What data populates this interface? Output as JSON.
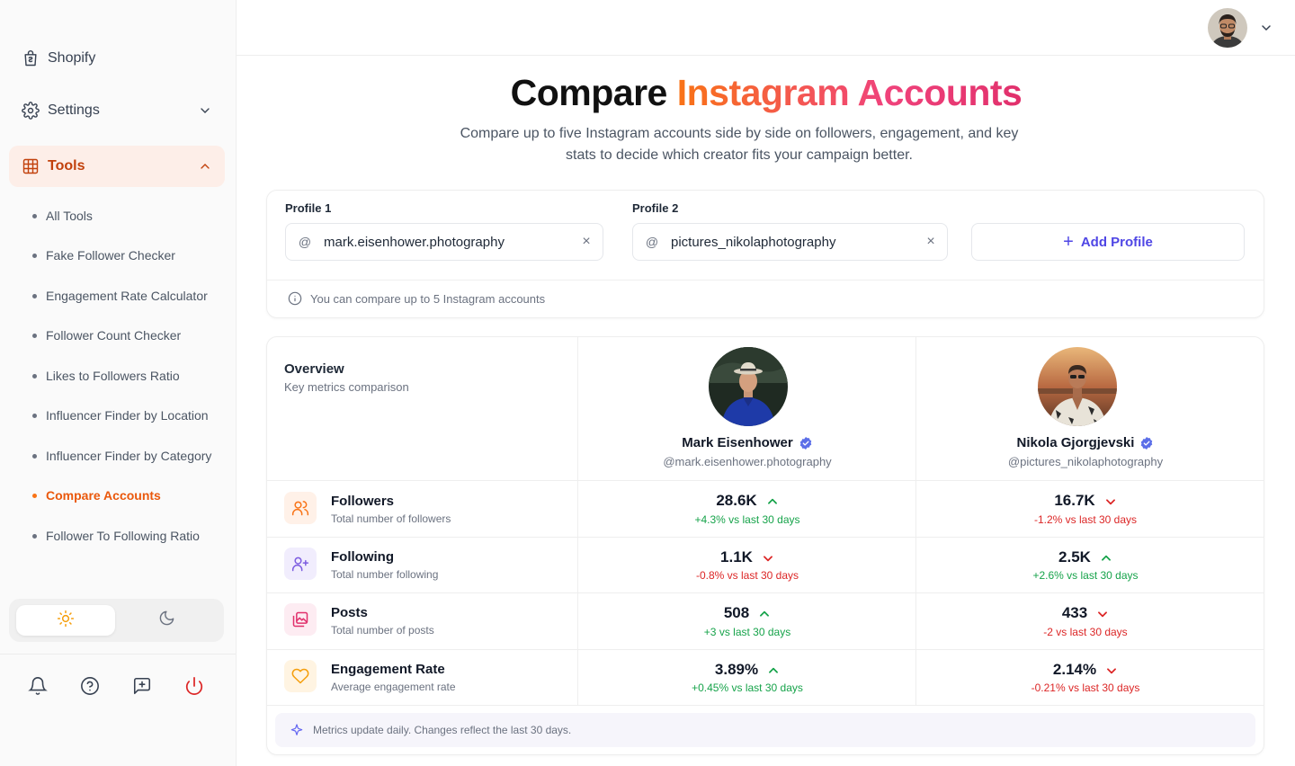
{
  "sidebar": {
    "shopify": "Shopify",
    "settings": "Settings",
    "tools": "Tools",
    "tool_items": [
      "All Tools",
      "Fake Follower Checker",
      "Engagement Rate Calculator",
      "Follower Count Checker",
      "Likes to Followers Ratio",
      "Influencer Finder by Location",
      "Influencer Finder by Category",
      "Compare Accounts",
      "Follower To Following Ratio"
    ],
    "active_item": "Compare Accounts",
    "theme_selected": "light",
    "footer_icons": [
      "bell-icon",
      "help-icon",
      "feedback-icon",
      "power-icon"
    ]
  },
  "header": {
    "user_menu_icon": "chevron-down-icon"
  },
  "hero": {
    "title_plain": "Compare ",
    "title_gradient": "Instagram Accounts",
    "subtitle": "Compare up to five Instagram accounts side by side on followers, engagement, and key stats to decide which creator fits your campaign better."
  },
  "profiles": {
    "profile1_label": "Profile 1",
    "profile1_value": "mark.eisenhower.photography",
    "profile2_label": "Profile 2",
    "profile2_value": "pictures_nikolaphotography",
    "at_symbol": "@",
    "clear_symbol": "×",
    "add_label": "Add Profile",
    "add_symbol": "+",
    "hint": "You can compare up to 5 Instagram accounts"
  },
  "overview": {
    "title": "Overview",
    "subtitle": "Key metrics comparison"
  },
  "accounts": [
    {
      "name": "Mark Eisenhower",
      "handle": "@mark.eisenhower.photography",
      "verified": true
    },
    {
      "name": "Nikola Gjorgjevski",
      "handle": "@pictures_nikolaphotography",
      "verified": true
    }
  ],
  "metrics": [
    {
      "name": "Followers",
      "desc": "Total number of followers",
      "icon": "users-icon",
      "icon_color": "#f97316",
      "icon_bg": "#fff1e8",
      "values": [
        {
          "value": "28.6K",
          "trend": "up",
          "delta": "+4.3%",
          "suffix": " vs last 30 days"
        },
        {
          "value": "16.7K",
          "trend": "down",
          "delta": "-1.2%",
          "suffix": " vs last 30 days"
        }
      ]
    },
    {
      "name": "Following",
      "desc": "Total number following",
      "icon": "user-plus-icon",
      "icon_color": "#7c5ce0",
      "icon_bg": "#f1edfd",
      "values": [
        {
          "value": "1.1K",
          "trend": "down",
          "delta": "-0.8%",
          "suffix": " vs last 30 days"
        },
        {
          "value": "2.5K",
          "trend": "up",
          "delta": "+2.6%",
          "suffix": " vs last 30 days"
        }
      ]
    },
    {
      "name": "Posts",
      "desc": "Total number of posts",
      "icon": "gallery-icon",
      "icon_color": "#e1306c",
      "icon_bg": "#fdecf2",
      "values": [
        {
          "value": "508",
          "trend": "up",
          "delta": "+3",
          "suffix": " vs last 30 days"
        },
        {
          "value": "433",
          "trend": "down",
          "delta": "-2",
          "suffix": " vs last 30 days"
        }
      ]
    },
    {
      "name": "Engagement Rate",
      "desc": "Average engagement rate",
      "icon": "heart-icon",
      "icon_color": "#f59e0b",
      "icon_bg": "#fff4e2",
      "values": [
        {
          "value": "3.89%",
          "trend": "up",
          "delta": "+0.45%",
          "suffix": " vs last 30 days"
        },
        {
          "value": "2.14%",
          "trend": "down",
          "delta": "-0.21%",
          "suffix": " vs last 30 days"
        }
      ]
    }
  ],
  "footnote": "Metrics update daily. Changes reflect the last 30 days.",
  "colors": {
    "accent": "#ea580c",
    "primary": "#4f46e5",
    "up": "#16a34a",
    "down": "#dc2626"
  }
}
